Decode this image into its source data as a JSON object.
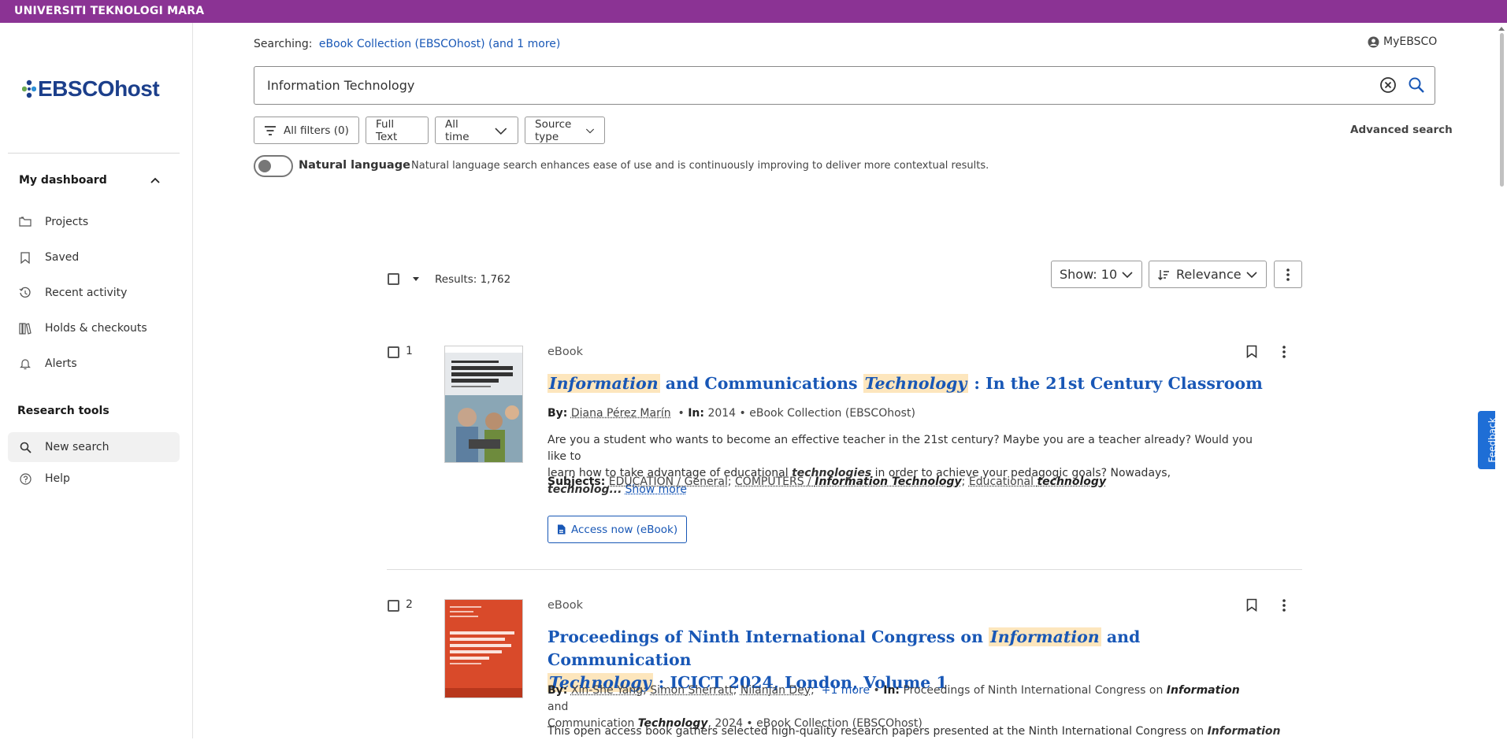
{
  "topbar": {
    "title": "UNIVERSITI TEKNOLOGI MARA"
  },
  "logo": {
    "text": "EBSCOhost"
  },
  "sidebar": {
    "dashboard_label": "My dashboard",
    "items": [
      {
        "label": "Projects",
        "icon": "folder-icon"
      },
      {
        "label": "Saved",
        "icon": "bookmark-icon"
      },
      {
        "label": "Recent activity",
        "icon": "history-icon"
      },
      {
        "label": "Holds & checkouts",
        "icon": "books-icon"
      },
      {
        "label": "Alerts",
        "icon": "bell-icon"
      }
    ],
    "research_tools_label": "Research tools",
    "tools": [
      {
        "label": "New search",
        "icon": "search-icon"
      },
      {
        "label": "Help",
        "icon": "help-icon"
      }
    ]
  },
  "header": {
    "searching_label": "Searching:",
    "searching_db": "eBook Collection (EBSCOhost) (and 1 more)",
    "myebsco": "MyEBSCO"
  },
  "search": {
    "value": "Information Technology"
  },
  "filters": {
    "all_filters": "All filters (0)",
    "full_text": "Full Text",
    "all_time": "All time",
    "source_type": "Source type",
    "advanced": "Advanced search"
  },
  "natural_language": {
    "label": "Natural language",
    "description": "Natural language search enhances ease of use and is continuously improving to deliver more contextual results.",
    "enabled": false
  },
  "results_bar": {
    "count": "Results: 1,762",
    "show": "Show: 10",
    "sort": "Relevance"
  },
  "results": [
    {
      "num": "1",
      "type": "eBook",
      "title_parts": [
        "Information",
        " and Communications ",
        "Technology",
        " : In the 21st Century Classroom"
      ],
      "by_label": "By:",
      "authors": [
        "Diana Pérez Marín"
      ],
      "in_label": "In:",
      "year": "2014",
      "source": "eBook Collection (EBSCOhost)",
      "abstract_1": "Are you a student who wants to become an effective teacher in the 21st century? Maybe you are a teacher already? Would you like to",
      "abstract_2a": "learn how to take advantage of educational ",
      "abstract_2b": "technologies",
      "abstract_2c": " in order to achieve your pedagogic goals? Nowadays, ",
      "abstract_2d": "technolog...",
      "show_more": "Show more",
      "subjects_label": "Subjects:",
      "subject_1": "EDUCATION / General",
      "subject_2a": "COMPUTERS / ",
      "subject_2b": "Information Technology",
      "subject_3a": "Educational ",
      "subject_3b": "technology",
      "access": "Access now (eBook)"
    },
    {
      "num": "2",
      "type": "eBook",
      "title_line1": [
        "Proceedings of Ninth International Congress on ",
        "Information",
        " and Communication"
      ],
      "title_line2": [
        "Technology",
        " : ICICT 2024, London, Volume 1"
      ],
      "by_label": "By:",
      "authors": [
        "Xin-She Yang",
        "Simon Sherratt",
        "Nilanjan Dey"
      ],
      "more_authors": "+1 more",
      "in_label": "In:",
      "in_text_a": "Proceedings of Ninth International Congress on ",
      "in_text_b": "Information",
      "in_text_c": " and",
      "in_text_d": "Communication ",
      "in_text_e": "Technology",
      "in_text_f": ", 2024 • eBook Collection (EBSCOhost)",
      "abstract_a": "This open access book gathers selected high-quality research papers presented at the Ninth International Congress on ",
      "abstract_b": "Information"
    }
  ],
  "feedback": "Feedback"
}
